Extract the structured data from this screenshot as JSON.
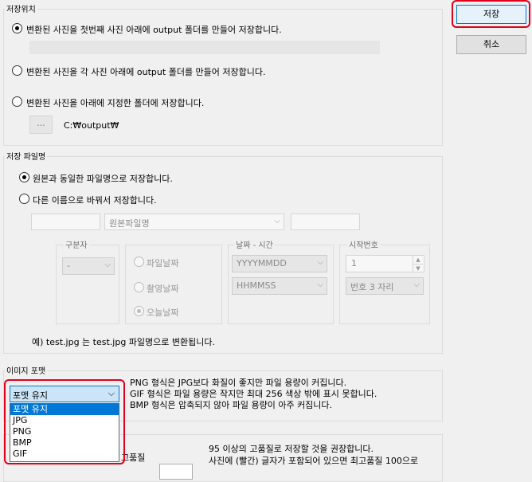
{
  "save_location": {
    "legend": "저장위치",
    "opt_first": "변환된 사진을 첫번째 사진 아래에 output 폴더를 만들어 저장합니다.",
    "opt_each": "변환된 사진을 각 사진 아래에 output 폴더를 만들어 저장합니다.",
    "opt_custom": "변환된 사진을 아래에 지정한 폴더에 저장합니다.",
    "browse_label": "...",
    "path": "C:₩output₩"
  },
  "filename": {
    "legend": "저장 파일명",
    "opt_same": "원본과 동일한 파일명으로 저장합니다.",
    "opt_rename": "다른 이름으로 바꿔서 저장합니다.",
    "name_combo": "원본파일명",
    "separator_legend": "구분자",
    "separator_value": "-",
    "date_options": [
      "파일날짜",
      "촬영날짜",
      "오늘날짜"
    ],
    "datetime_legend": "날짜 - 시간",
    "date_format": "YYYYMMDD",
    "time_format": "HHMMSS",
    "start_legend": "시작번호",
    "start_value": "1",
    "digits": "번호 3 자리",
    "example": "예) test.jpg 는 test.jpg  파일명으로 변환됩니다."
  },
  "image_format": {
    "legend": "이미지 포맷",
    "selected": "포맷 유지",
    "options": [
      "포맷 유지",
      "JPG",
      "PNG",
      "BMP",
      "GIF"
    ],
    "info": [
      "PNG 형식은 JPG보다 화질이 좋지만 파일 용량이 커집니다.",
      "GIF 형식은 파일 용량은 작지만 최대 256 색상 밖에 표시 못합니다.",
      "BMP 형식은 압축되지 않아 파일 용량이 아주 커집니다."
    ]
  },
  "quality": {
    "partial_label": "고품질",
    "info": [
      "95 이상의 고품질로 저장할 것을 권장합니다.",
      "사진에 (빨간) 글자가 포함되어 있으면 최고품질 100으로"
    ]
  },
  "buttons": {
    "save": "저장",
    "cancel": "취소"
  },
  "colors": {
    "highlight": "#e2001a",
    "selection": "#0078d7",
    "combo_active": "#cce4f7"
  }
}
